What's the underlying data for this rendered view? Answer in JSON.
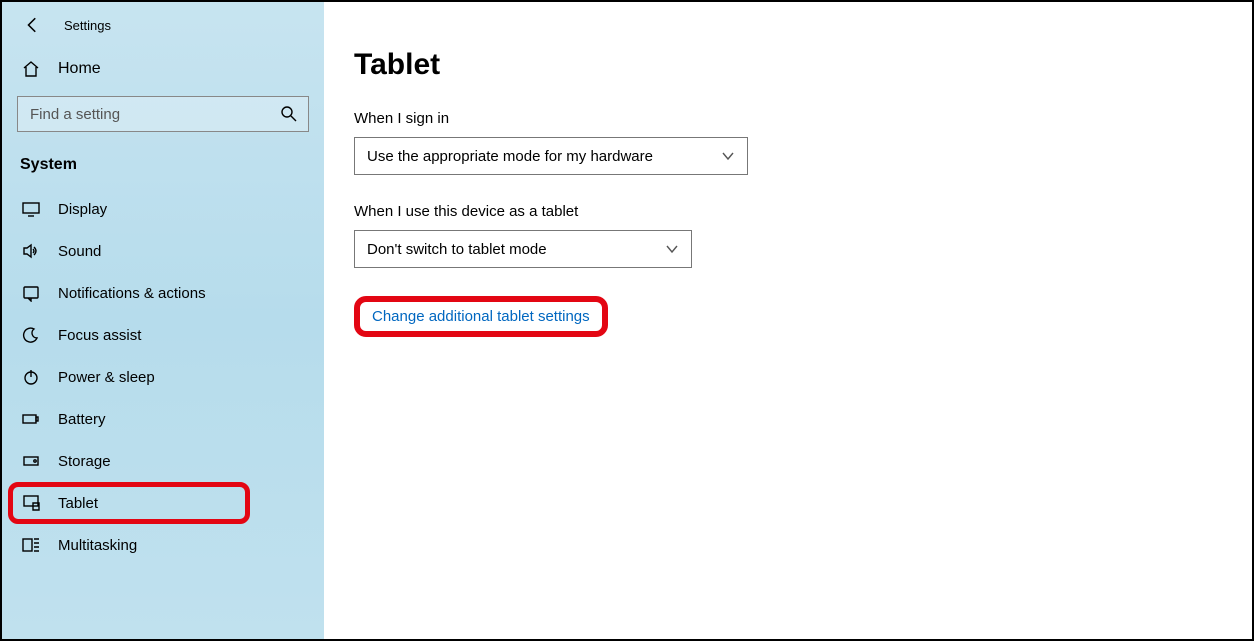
{
  "titlebar": {
    "app_name": "Settings"
  },
  "home": {
    "label": "Home"
  },
  "search": {
    "placeholder": "Find a setting"
  },
  "category": {
    "label": "System"
  },
  "nav": {
    "display": "Display",
    "sound": "Sound",
    "notifications": "Notifications & actions",
    "focus": "Focus assist",
    "power": "Power & sleep",
    "battery": "Battery",
    "storage": "Storage",
    "tablet": "Tablet",
    "multitasking": "Multitasking"
  },
  "page": {
    "title": "Tablet",
    "signin_label": "When I sign in",
    "signin_value": "Use the appropriate mode for my hardware",
    "device_label": "When I use this device as a tablet",
    "device_value": "Don't switch to tablet mode",
    "link": "Change additional tablet settings"
  }
}
